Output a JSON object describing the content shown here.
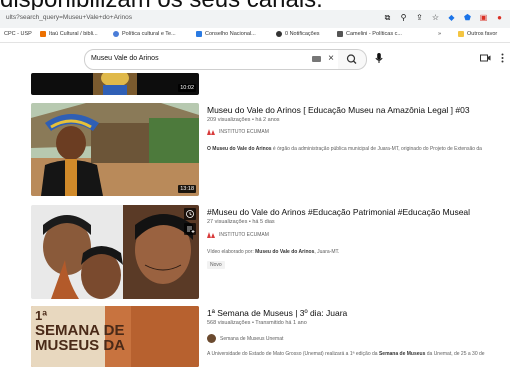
{
  "overlay_caption": "disponibilizam os seus canais.",
  "browser": {
    "url": "ults?search_query=Museu+Vale+do+Arinos",
    "bookmarks": [
      {
        "label": "CPC - USP",
        "color": "#ffffff"
      },
      {
        "label": "Itaú Cultural / bibli...",
        "color": "#ec7000"
      },
      {
        "label": "Política cultural e Te...",
        "color": "#4a7dd8"
      },
      {
        "label": "Conselho Nacional...",
        "color": "#2a7ae2"
      },
      {
        "label": "0 Notificações",
        "color": "#333333"
      },
      {
        "label": "Camelini - Políticas c...",
        "color": "#555555"
      },
      {
        "label": "Outros favor",
        "color": "#f4c542"
      }
    ],
    "overflow": "»"
  },
  "search": {
    "query": "Museu Vale do Arinos"
  },
  "videos": [
    {
      "title": "",
      "duration": "10:02"
    },
    {
      "title": "Museu do Vale do Arinos [ Educação Museu na Amazônia Legal ] #03",
      "meta": "209 visualizações • há 2 anos",
      "channel": "INSTITUTO ECUMAM",
      "description_bold": "O Museu do Vale do Arinos",
      "description_rest": " é órgão da administração pública municipal de Juara-MT, originado do Projeto de Extensão da",
      "duration": "13:18"
    },
    {
      "title": "#Museu do Vale do Arinos #Educação Patrimonial #Educação Museal",
      "meta": "27 visualizações • há 5 dias",
      "channel": "INSTITUTO ECUMAM",
      "description_plain": "Vídeo elaborado por: ",
      "description_bold": "Museu do Vale do Arinos",
      "description_rest": ", Juara-MT.",
      "badge": "Novo"
    },
    {
      "title": "1ª Semana de Museus | 3º dia: Juara",
      "meta": "568 visualizações • Transmitido há 1 ano",
      "channel": "Semana de Museus Unemat",
      "description_plain": "A Universidade do Estado de Mato Grosso (Unemat) realizará a 1ª edição da ",
      "description_bold": "Semana de Museus",
      "description_rest": " da Unemat, de 25 a 30 de",
      "thumb_text": [
        "1ª",
        "SEMANA DE",
        "MUSEUS DA"
      ]
    }
  ],
  "colors": {
    "ecumam_logo": "#d83b3b",
    "thumb4_bg": "#c8733f"
  }
}
